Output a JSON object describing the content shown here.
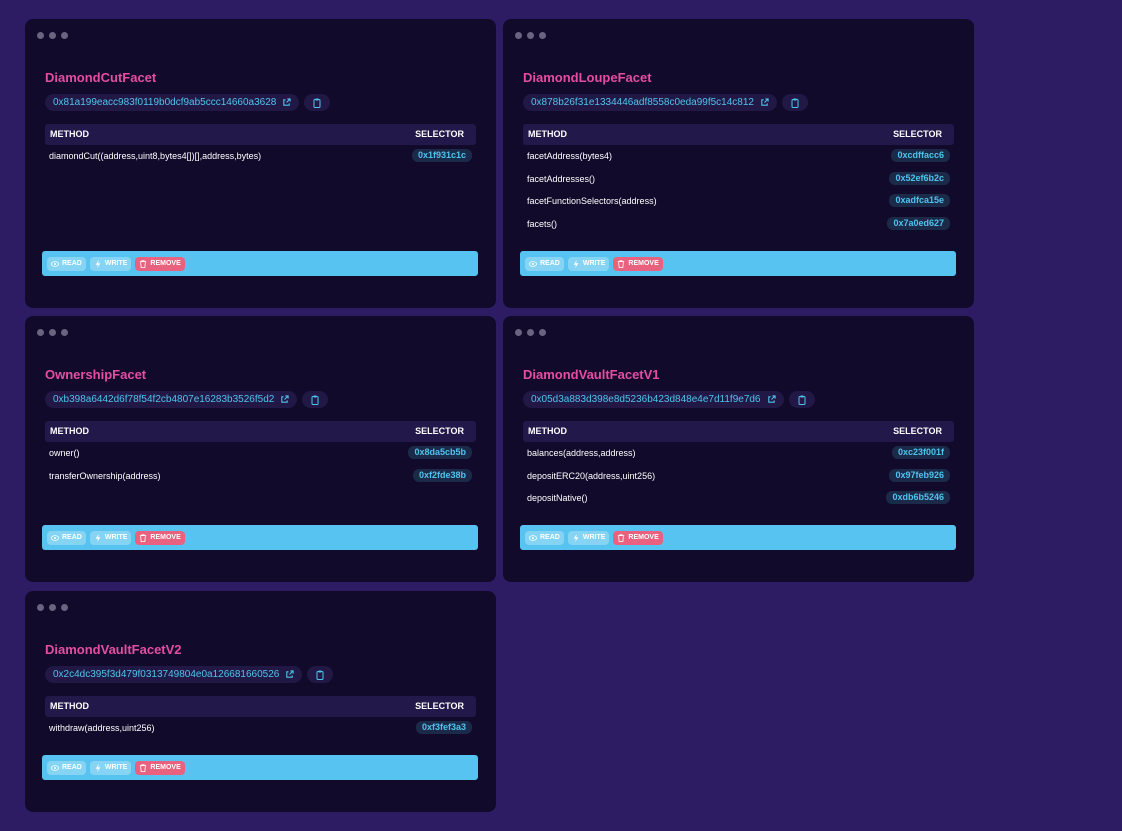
{
  "headers": {
    "method": "METHOD",
    "selector": "SELECTOR"
  },
  "actions": {
    "read": "READ",
    "write": "WRITE",
    "remove": "REMOVE"
  },
  "facets": [
    {
      "name": "DiamondCutFacet",
      "address": "0x81a199eacc983f0119b0dcf9ab5ccc14660a3628",
      "methods": [
        {
          "method": "diamondCut((address,uint8,bytes4[])[],address,bytes)",
          "selector": "0x1f931c1c"
        }
      ]
    },
    {
      "name": "DiamondLoupeFacet",
      "address": "0x878b26f31e1334446adf8558c0eda99f5c14c812",
      "methods": [
        {
          "method": "facetAddress(bytes4)",
          "selector": "0xcdffacc6"
        },
        {
          "method": "facetAddresses()",
          "selector": "0x52ef6b2c"
        },
        {
          "method": "facetFunctionSelectors(address)",
          "selector": "0xadfca15e"
        },
        {
          "method": "facets()",
          "selector": "0x7a0ed627"
        }
      ]
    },
    {
      "name": "OwnershipFacet",
      "address": "0xb398a6442d6f78f54f2cb4807e16283b3526f5d2",
      "methods": [
        {
          "method": "owner()",
          "selector": "0x8da5cb5b"
        },
        {
          "method": "transferOwnership(address)",
          "selector": "0xf2fde38b"
        }
      ]
    },
    {
      "name": "DiamondVaultFacetV1",
      "address": "0x05d3a883d398e8d5236b423d848e4e7d11f9e7d6",
      "methods": [
        {
          "method": "balances(address,address)",
          "selector": "0xc23f001f"
        },
        {
          "method": "depositERC20(address,uint256)",
          "selector": "0x97feb926"
        },
        {
          "method": "depositNative()",
          "selector": "0xdb6b5246"
        }
      ]
    },
    {
      "name": "DiamondVaultFacetV2",
      "address": "0x2c4dc395f3d479f0313749804e0a126681660526",
      "methods": [
        {
          "method": "withdraw(address,uint256)",
          "selector": "0xf3fef3a3"
        }
      ]
    }
  ],
  "icons": {
    "external": "external-link-icon",
    "copy": "copy-icon",
    "read": "eye-icon",
    "write": "lightning-icon",
    "remove": "trash-icon"
  },
  "colors": {
    "background": "#2d1b63",
    "card": "#120a2b",
    "title": "#e44ea2",
    "address": "#4fc3ee",
    "action_bar": "#57c3f0",
    "remove": "#e8627f"
  }
}
